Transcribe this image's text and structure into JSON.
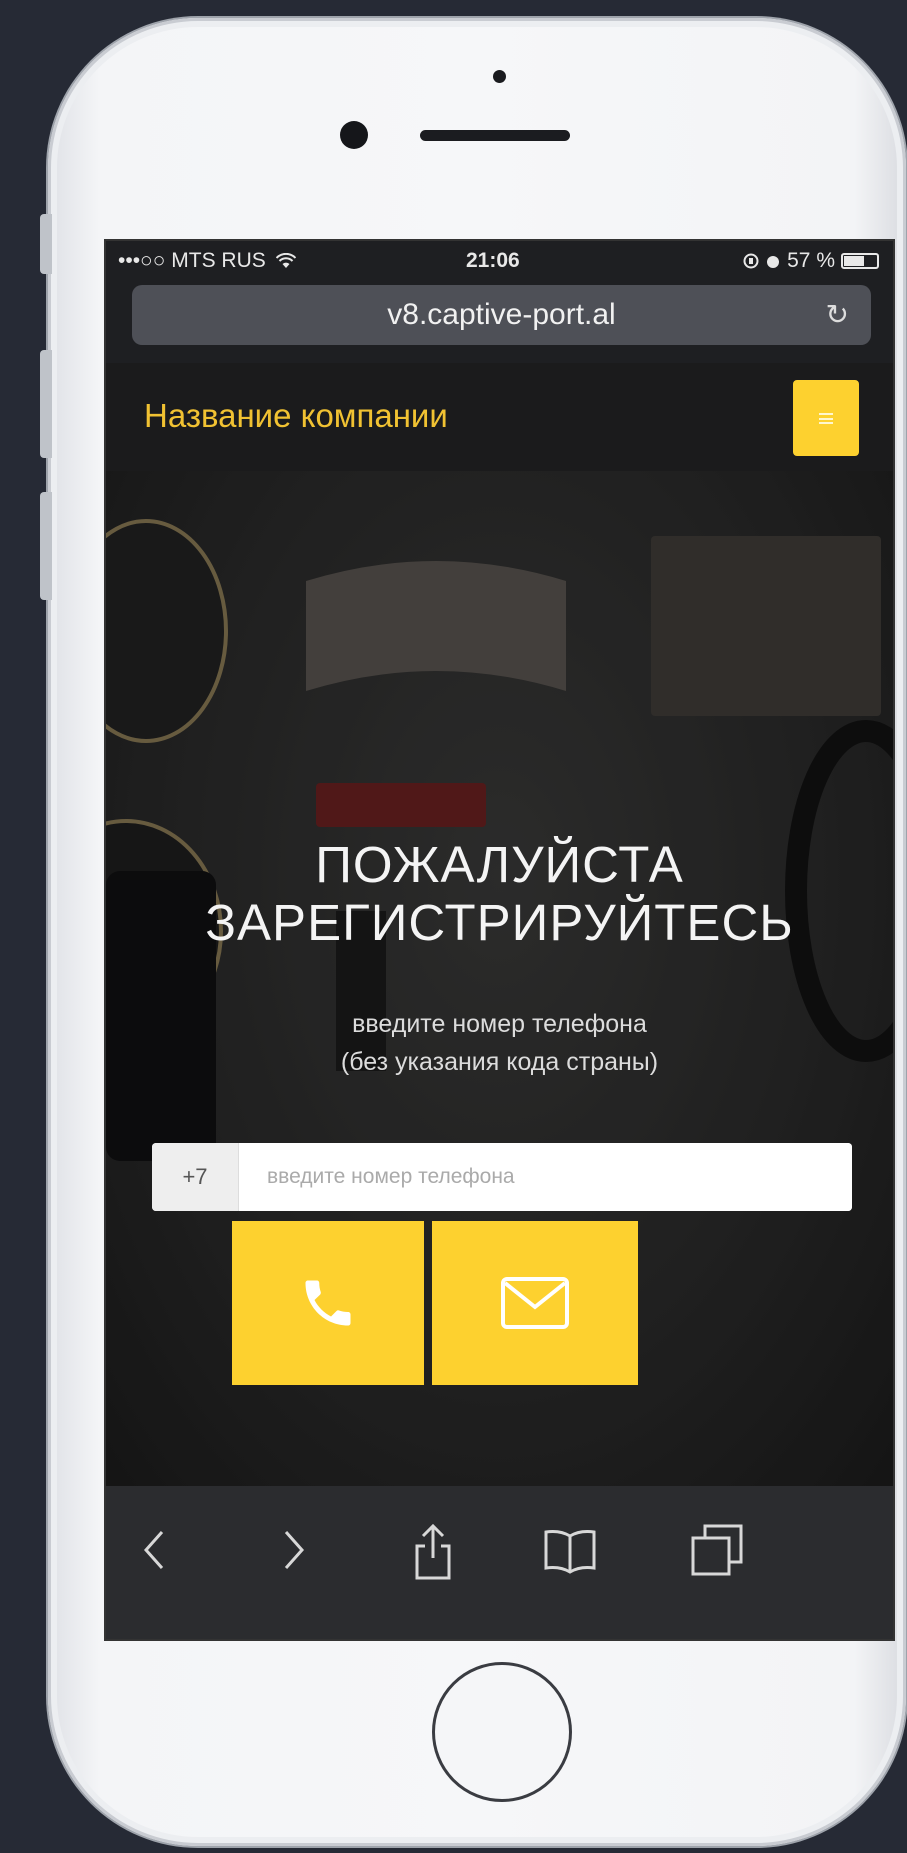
{
  "status_bar": {
    "carrier": "•••○○ MTS RUS",
    "time": "21:06",
    "battery": "57 %"
  },
  "browser": {
    "url": "v8.captive-port.al"
  },
  "header": {
    "brand": "Название компании"
  },
  "hero": {
    "title_line1": "ПОЖАЛУЙСТА",
    "title_line2": "ЗАРЕГИСТРИРУЙТЕСЬ",
    "subtitle_line1": "введите номер телефона",
    "subtitle_line2": "(без указания кода страны)",
    "phone_prefix": "+7",
    "phone_placeholder": "введите номер телефона",
    "phone_value": ""
  },
  "colors": {
    "accent": "#fdd12f",
    "brand_text": "#f1c232"
  },
  "icons": {
    "call_button": "phone-icon",
    "email_button": "envelope-icon",
    "toolbar": [
      "back-icon",
      "forward-icon",
      "share-icon",
      "bookmarks-icon",
      "tabs-icon"
    ]
  }
}
